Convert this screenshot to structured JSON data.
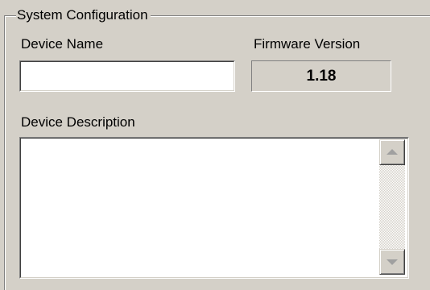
{
  "group": {
    "title": "System Configuration"
  },
  "device_name": {
    "label": "Device Name",
    "value": ""
  },
  "firmware": {
    "label": "Firmware Version",
    "value": "1.18"
  },
  "device_description": {
    "label": "Device Description",
    "value": ""
  },
  "scrollbar": {
    "up_icon": "arrow-up-icon",
    "down_icon": "arrow-down-icon",
    "enabled": false
  },
  "colors": {
    "face": "#d4d0c8",
    "field": "#ffffff",
    "shadow": "#808080",
    "disabled_arrow": "#a0a0a0"
  }
}
